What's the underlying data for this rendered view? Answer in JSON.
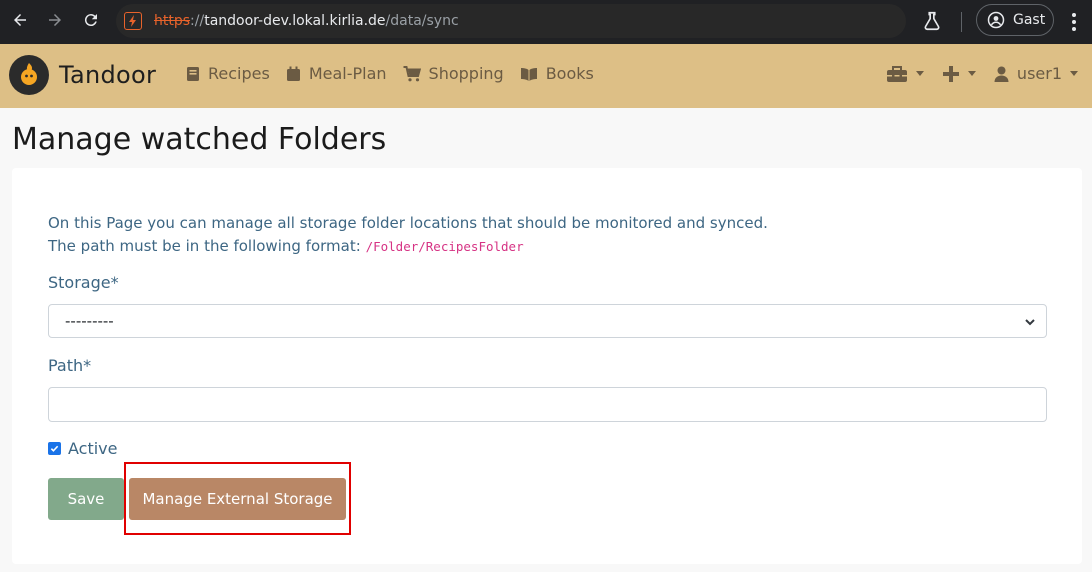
{
  "browser": {
    "url_scheme": "https",
    "url_separator": "://",
    "url_host": "tandoor-dev.lokal.kirlia.de",
    "url_path": "/data/sync",
    "profile_label": "Gast"
  },
  "navbar": {
    "brand": "Tandoor",
    "links": [
      {
        "label": "Recipes",
        "icon": "book-icon"
      },
      {
        "label": "Meal-Plan",
        "icon": "calendar-icon"
      },
      {
        "label": "Shopping",
        "icon": "cart-icon"
      },
      {
        "label": "Books",
        "icon": "open-book-icon"
      }
    ],
    "user_label": "user1"
  },
  "page": {
    "title": "Manage watched Folders",
    "intro_line1": "On this Page you can manage all storage folder locations that should be monitored and synced.",
    "intro_line2": "The path must be in the following format:",
    "path_example": "/Folder/RecipesFolder",
    "storage_label": "Storage*",
    "storage_value": "---------",
    "path_label": "Path*",
    "path_value": "",
    "active_label": "Active",
    "active_checked": true,
    "save_label": "Save",
    "manage_storage_label": "Manage External Storage"
  },
  "colors": {
    "navbar_bg": "#ddbf86",
    "save_button": "#82a98b",
    "manage_button": "#b98766",
    "highlight": "#e00000",
    "text_blue": "#3d6683"
  }
}
